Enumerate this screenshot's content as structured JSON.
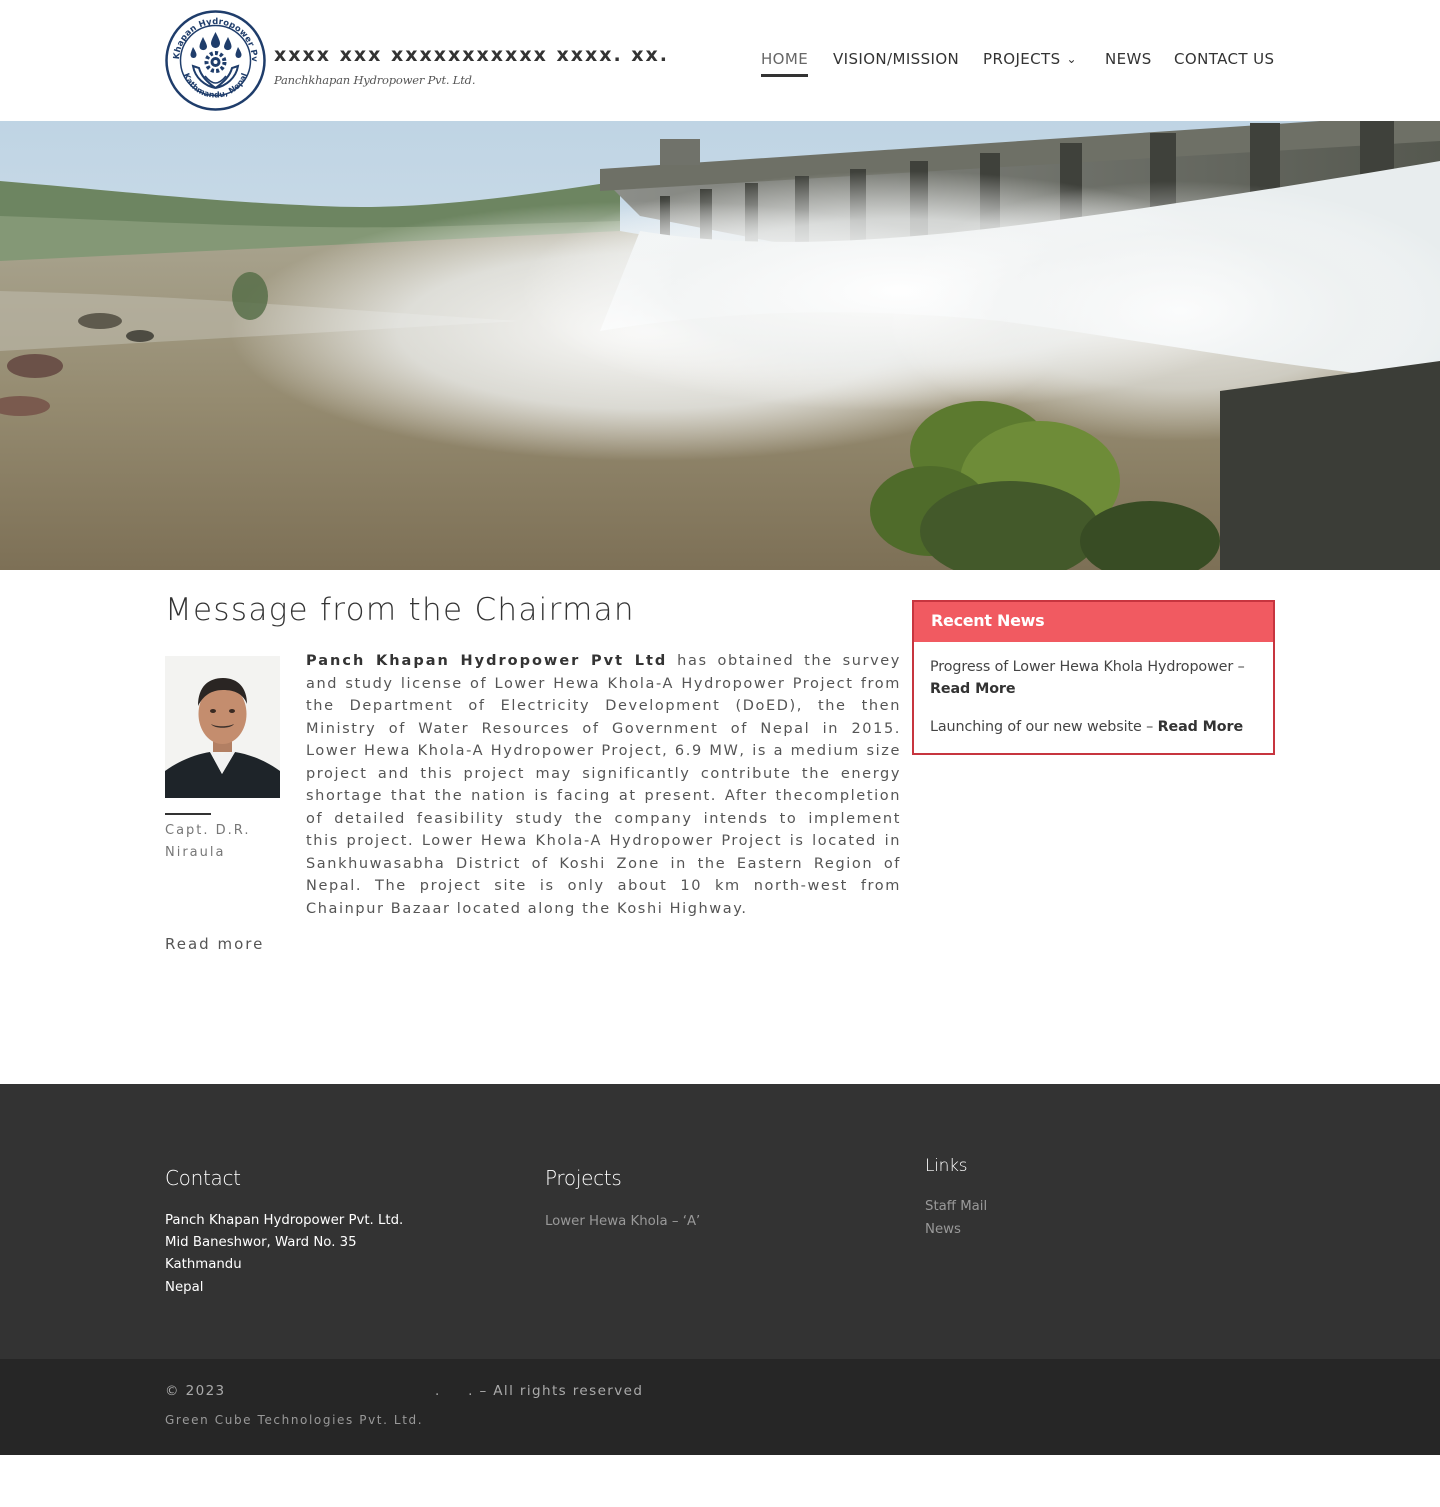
{
  "header": {
    "site_title": "xxxx xxx xxxxxxxxxxx xxxx. xx.",
    "tagline": "Panchkhapan Hydropower Pvt. Ltd.",
    "logo_ring_text": "Panch Khapan Hydropower Pvt. Ltd.",
    "logo_bottom_text": "Kathmandu, Nepal",
    "nav": {
      "home": "HOME",
      "vision": "VISION/MISSION",
      "projects": "PROJECTS",
      "news": "NEWS",
      "contact": "CONTACT US"
    }
  },
  "hero": {
    "image": "dam-spillway-photo"
  },
  "chairman": {
    "title": "Message from the Chairman",
    "name": "Capt. D.R. Niraula",
    "company_bold": "Panch Khapan Hydropower Pvt Ltd",
    "message": " has obtained the survey and study license of Lower Hewa Khola-A Hydropower Project from the Department of Electricity Development (DoED), the then Ministry of Water Resources of Government of Nepal in 2015.  Lower Hewa Khola-A Hydropower Project, 6.9 MW, is a medium size project and this project may significantly contribute the energy shortage that the nation is facing at present. After thecompletion of detailed feasibility study the company intends to implement this project. Lower Hewa Khola-A Hydropower Project is located in Sankhuwasabha District of Koshi Zone in the Eastern Region of Nepal. The project site is only about 10 km north-west from Chainpur Bazaar located along the Koshi Highway.",
    "read_more": "Read more"
  },
  "recent_news": {
    "title": "Recent News",
    "items": [
      {
        "text": "Progress of Lower Hewa Khola Hydropower –",
        "link": "Read More"
      },
      {
        "text": "Launching of our new website –",
        "link": "Read More"
      }
    ]
  },
  "footer": {
    "contact": {
      "title": "Contact",
      "lines": [
        "Panch Khapan Hydropower Pvt. Ltd.",
        "Mid Baneshwor, Ward No. 35",
        "Kathmandu",
        "Nepal"
      ]
    },
    "projects": {
      "title": "Projects",
      "items": [
        "Lower Hewa Khola – ‘A’"
      ]
    },
    "links": {
      "title": "Links",
      "items": [
        "Staff Mail",
        "News"
      ]
    }
  },
  "bottom": {
    "copyright": "© 2023",
    "copyright_mid": ".",
    "copyright_end": ". – All rights reserved",
    "credit": "Green Cube Technologies Pvt. Ltd."
  },
  "colors": {
    "accent_red": "#f15a61",
    "accent_border": "#c7353f",
    "footer_bg": "#333333",
    "bottom_bg": "#262626",
    "logo_blue": "#1f3d6b"
  }
}
